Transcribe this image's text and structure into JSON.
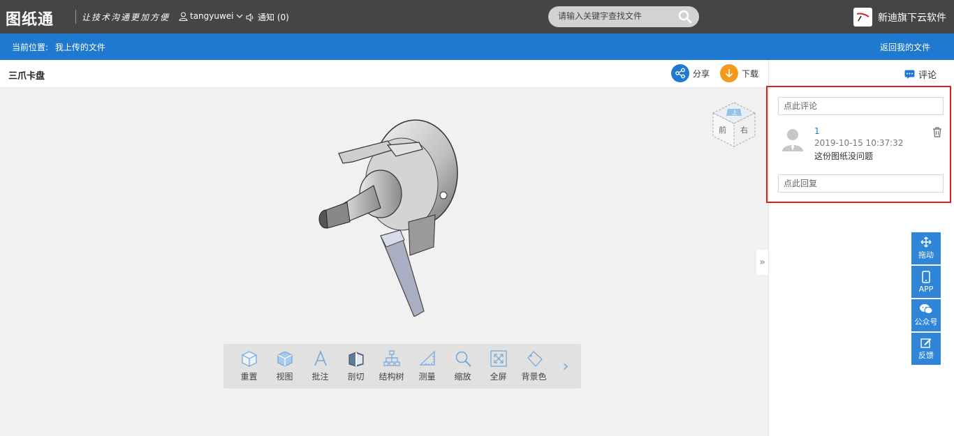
{
  "header": {
    "logo": "图纸通",
    "slogan": "让技术沟通更加方便",
    "username": "tangyuwei",
    "notice": "通知 (0)",
    "search_placeholder": "请输入关键字查找文件",
    "brand": "新迪旗下云软件"
  },
  "breadcrumb": {
    "label": "当前位置:",
    "current": "我上传的文件",
    "back": "返回我的文件"
  },
  "file": {
    "title": "三爪卡盘",
    "share": "分享",
    "download": "下载"
  },
  "viewcube": {
    "front": "前",
    "right": "右",
    "top": "上"
  },
  "toolbar": {
    "items": [
      {
        "label": "重置",
        "icon": "reset-cube-icon"
      },
      {
        "label": "视图",
        "icon": "view-cube-icon"
      },
      {
        "label": "批注",
        "icon": "annotate-icon"
      },
      {
        "label": "剖切",
        "icon": "section-icon"
      },
      {
        "label": "结构树",
        "icon": "tree-icon"
      },
      {
        "label": "测量",
        "icon": "measure-icon"
      },
      {
        "label": "缩放",
        "icon": "zoom-icon"
      },
      {
        "label": "全屏",
        "icon": "fullscreen-icon"
      },
      {
        "label": "背景色",
        "icon": "background-icon"
      }
    ]
  },
  "comments": {
    "tab": "评论",
    "input_placeholder": "点此评论",
    "items": [
      {
        "author": "1",
        "time": "2019-10-15 10:37:32",
        "text": "这份图纸没问题"
      }
    ],
    "reply_placeholder": "点此回复"
  },
  "side_buttons": [
    {
      "label": "拖动",
      "icon": "move-icon"
    },
    {
      "label": "APP",
      "icon": "phone-icon"
    },
    {
      "label": "公众号",
      "icon": "wechat-icon"
    },
    {
      "label": "反馈",
      "icon": "edit-icon"
    }
  ],
  "colors": {
    "topbar": "#454545",
    "accent": "#1e79cf",
    "share": "#1e79cf",
    "download": "#f39a1e",
    "highlight": "#e02020"
  }
}
